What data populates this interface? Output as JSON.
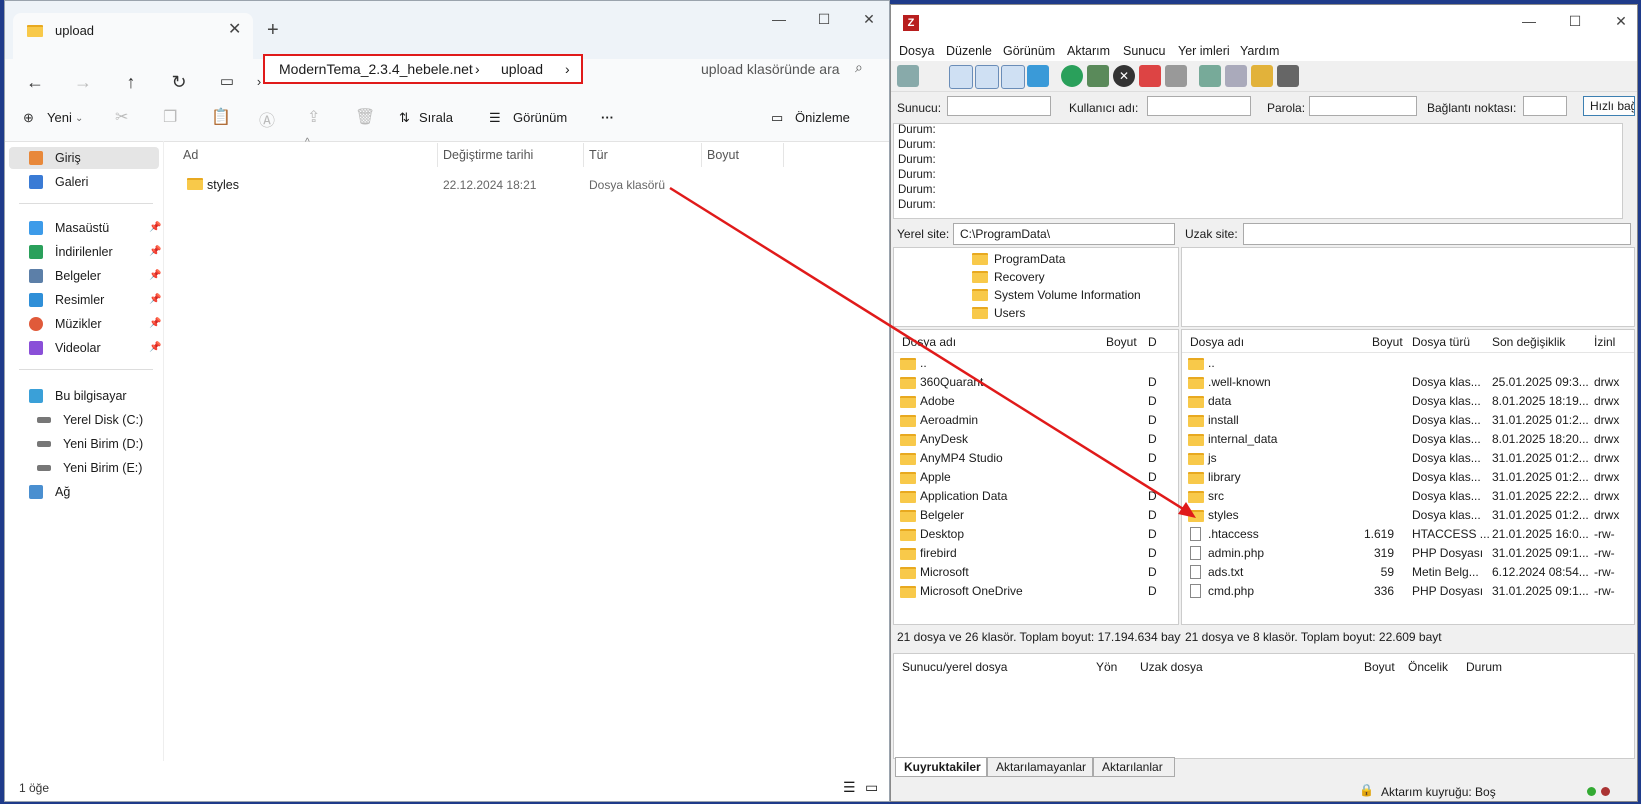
{
  "explorer": {
    "tab_title": "upload",
    "breadcrumb": [
      "ModernTema_2.3.4_hebele.net",
      "upload"
    ],
    "search_placeholder": "upload klasöründe ara",
    "toolbar": {
      "new": "Yeni",
      "sort": "Sırala",
      "view": "Görünüm",
      "more": "···",
      "preview": "Önizleme"
    },
    "sidebar": {
      "top": [
        "Giriş",
        "Galeri"
      ],
      "quick": [
        "Masaüstü",
        "İndirilenler",
        "Belgeler",
        "Resimler",
        "Müzikler",
        "Videolar"
      ],
      "this_pc": "Bu bilgisayar",
      "drives": [
        "Yerel Disk (C:)",
        "Yeni Birim (D:)",
        "Yeni Birim (E:)"
      ],
      "network": "Ağ"
    },
    "columns": [
      "Ad",
      "Değiştirme tarihi",
      "Tür",
      "Boyut"
    ],
    "rows": [
      {
        "name": "styles",
        "date": "22.12.2024 18:21",
        "type": "Dosya klasörü",
        "size": ""
      }
    ],
    "status": "1 öğe"
  },
  "filezilla": {
    "menu": [
      "Dosya",
      "Düzenle",
      "Görünüm",
      "Aktarım",
      "Sunucu",
      "Yer imleri",
      "Yardım"
    ],
    "quickconnect": {
      "host": "Sunucu:",
      "user": "Kullanıcı adı:",
      "pass": "Parola:",
      "port": "Bağlantı noktası:",
      "button": "Hızlı bağ"
    },
    "log": [
      "Durum:",
      "Durum:",
      "Durum:",
      "Durum:",
      "Durum:",
      "Durum:"
    ],
    "local_site_label": "Yerel site:",
    "local_site_path": "C:\\ProgramData\\",
    "remote_site_label": "Uzak site:",
    "local_tree": [
      "ProgramData",
      "Recovery",
      "System Volume Information",
      "Users"
    ],
    "local_columns": [
      "Dosya adı",
      "Boyut",
      "D"
    ],
    "local_files": [
      "..",
      "360Quarant",
      "Adobe",
      "Aeroadmin",
      "AnyDesk",
      "AnyMP4 Studio",
      "Apple",
      "Application Data",
      "Belgeler",
      "Desktop",
      "firebird",
      "Microsoft",
      "Microsoft OneDrive"
    ],
    "local_type_abbrev": "D",
    "local_status": "21 dosya ve 26 klasör. Toplam boyut: 17.194.634 bayt",
    "remote_columns": [
      "Dosya adı",
      "Boyut",
      "Dosya türü",
      "Son değişiklik",
      "İzinl"
    ],
    "remote_files": [
      {
        "name": "..",
        "size": "",
        "type": "",
        "date": "",
        "perm": "",
        "folder": true
      },
      {
        "name": ".well-known",
        "size": "",
        "type": "Dosya klas...",
        "date": "25.01.2025 09:3...",
        "perm": "drwx",
        "folder": true
      },
      {
        "name": "data",
        "size": "",
        "type": "Dosya klas...",
        "date": "8.01.2025 18:19...",
        "perm": "drwx",
        "folder": true
      },
      {
        "name": "install",
        "size": "",
        "type": "Dosya klas...",
        "date": "31.01.2025 01:2...",
        "perm": "drwx",
        "folder": true
      },
      {
        "name": "internal_data",
        "size": "",
        "type": "Dosya klas...",
        "date": "8.01.2025 18:20...",
        "perm": "drwx",
        "folder": true
      },
      {
        "name": "js",
        "size": "",
        "type": "Dosya klas...",
        "date": "31.01.2025 01:2...",
        "perm": "drwx",
        "folder": true
      },
      {
        "name": "library",
        "size": "",
        "type": "Dosya klas...",
        "date": "31.01.2025 01:2...",
        "perm": "drwx",
        "folder": true
      },
      {
        "name": "src",
        "size": "",
        "type": "Dosya klas...",
        "date": "31.01.2025 22:2...",
        "perm": "drwx",
        "folder": true
      },
      {
        "name": "styles",
        "size": "",
        "type": "Dosya klas...",
        "date": "31.01.2025 01:2...",
        "perm": "drwx",
        "folder": true
      },
      {
        "name": ".htaccess",
        "size": "1.619",
        "type": "HTACCESS ...",
        "date": "21.01.2025 16:0...",
        "perm": "-rw-",
        "folder": false
      },
      {
        "name": "admin.php",
        "size": "319",
        "type": "PHP Dosyası",
        "date": "31.01.2025 09:1...",
        "perm": "-rw-",
        "folder": false
      },
      {
        "name": "ads.txt",
        "size": "59",
        "type": "Metin Belg...",
        "date": "6.12.2024 08:54...",
        "perm": "-rw-",
        "folder": false
      },
      {
        "name": "cmd.php",
        "size": "336",
        "type": "PHP Dosyası",
        "date": "31.01.2025 09:1...",
        "perm": "-rw-",
        "folder": false
      }
    ],
    "remote_status": "21 dosya ve 8 klasör. Toplam boyut: 22.609 bayt",
    "queue_columns": [
      "Sunucu/yerel dosya",
      "Yön",
      "Uzak dosya",
      "Boyut",
      "Öncelik",
      "Durum"
    ],
    "queue_tabs": [
      "Kuyruktakiler",
      "Aktarılamayanlar",
      "Aktarılanlar"
    ],
    "queue_status": "Aktarım kuyruğu: Boş"
  },
  "colors": {
    "annotation_red": "#e01a1a",
    "folder_yellow": "#f8c94a",
    "desktop_blue": "#1f3b8a"
  }
}
